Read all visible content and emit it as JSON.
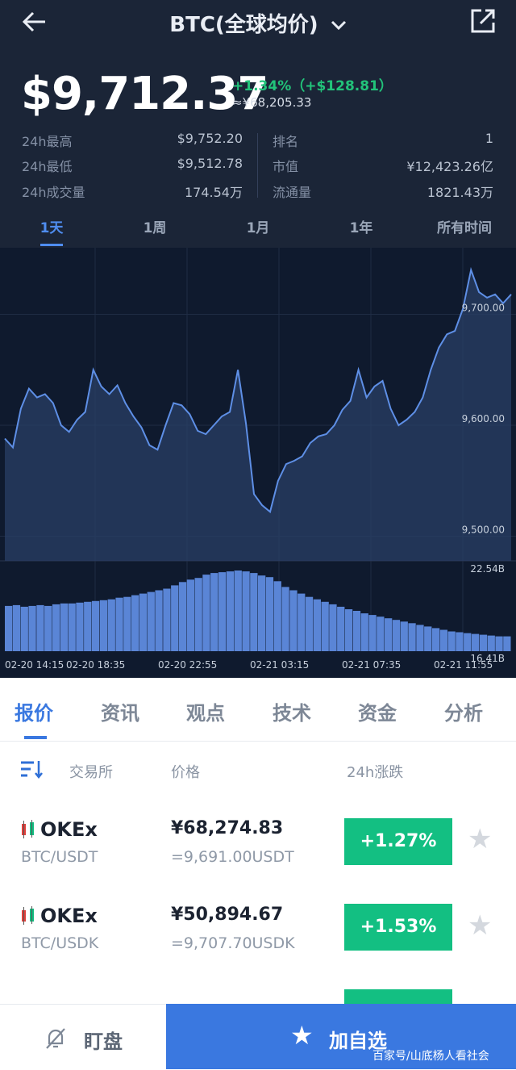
{
  "header": {
    "title": "BTC(全球均价)"
  },
  "price": {
    "main": "$9,712.37",
    "change": "+1.34%（+$128.81）",
    "cny": "≈¥68,205.33"
  },
  "stats": {
    "left": [
      {
        "label": "24h最高",
        "value": "$9,752.20"
      },
      {
        "label": "24h最低",
        "value": "$9,512.78"
      },
      {
        "label": "24h成交量",
        "value": "174.54万"
      }
    ],
    "right": [
      {
        "label": "排名",
        "value": "1"
      },
      {
        "label": "市值",
        "value": "¥12,423.26亿"
      },
      {
        "label": "流通量",
        "value": "1821.43万"
      }
    ]
  },
  "range_tabs": [
    "1天",
    "1周",
    "1月",
    "1年",
    "所有时间"
  ],
  "chart_data": {
    "type": "line",
    "price_series": [
      9588,
      9580,
      9615,
      9633,
      9625,
      9628,
      9620,
      9600,
      9594,
      9605,
      9612,
      9650,
      9635,
      9628,
      9636,
      9620,
      9608,
      9598,
      9582,
      9578,
      9600,
      9620,
      9618,
      9610,
      9595,
      9592,
      9600,
      9608,
      9612,
      9650,
      9602,
      9538,
      9528,
      9522,
      9550,
      9565,
      9568,
      9572,
      9584,
      9590,
      9592,
      9600,
      9614,
      9622,
      9650,
      9625,
      9635,
      9640,
      9615,
      9600,
      9605,
      9612,
      9625,
      9650,
      9670,
      9682,
      9685,
      9705,
      9740,
      9720,
      9715,
      9718,
      9710,
      9718
    ],
    "volume_series": [
      0.55,
      0.56,
      0.54,
      0.55,
      0.56,
      0.55,
      0.57,
      0.58,
      0.58,
      0.59,
      0.6,
      0.61,
      0.62,
      0.63,
      0.65,
      0.66,
      0.68,
      0.7,
      0.72,
      0.74,
      0.76,
      0.8,
      0.84,
      0.87,
      0.89,
      0.93,
      0.95,
      0.96,
      0.97,
      0.98,
      0.97,
      0.95,
      0.92,
      0.9,
      0.85,
      0.78,
      0.74,
      0.7,
      0.66,
      0.63,
      0.6,
      0.57,
      0.54,
      0.51,
      0.49,
      0.46,
      0.44,
      0.42,
      0.4,
      0.38,
      0.36,
      0.34,
      0.32,
      0.3,
      0.28,
      0.26,
      0.24,
      0.23,
      0.22,
      0.21,
      0.2,
      0.19,
      0.18,
      0.18
    ],
    "y_ticks": [
      "9,700.00",
      "9,600.00",
      "9,500.00"
    ],
    "volume_max_label": "22.54B",
    "volume_min_label": "16.41B",
    "x_ticks": [
      "02-20 14:15",
      "02-20 18:35",
      "02-20 22:55",
      "02-21 03:15",
      "02-21 07:35",
      "02-21 11:55"
    ],
    "ylim": [
      9480,
      9760
    ],
    "colors": {
      "line": "#5e8fe6",
      "fill": "#2a3f66",
      "bar": "#5a85d6"
    }
  },
  "info_tabs": [
    "报价",
    "资讯",
    "观点",
    "技术",
    "资金",
    "分析"
  ],
  "table": {
    "headers": {
      "exchange": "交易所",
      "price": "价格",
      "change": "24h涨跌"
    },
    "rows": [
      {
        "exchange": "OKEx",
        "pair": "BTC/USDT",
        "price": "¥68,274.83",
        "usd": "=9,691.00USDT",
        "change": "+1.27%"
      },
      {
        "exchange": "OKEx",
        "pair": "BTC/USDK",
        "price": "¥50,894.67",
        "usd": "=9,707.70USDK",
        "change": "+1.53%"
      }
    ]
  },
  "bottom": {
    "watch_label": "盯盘",
    "add_label": "加自选",
    "watermark": "百家号/山底杨人看社会"
  }
}
